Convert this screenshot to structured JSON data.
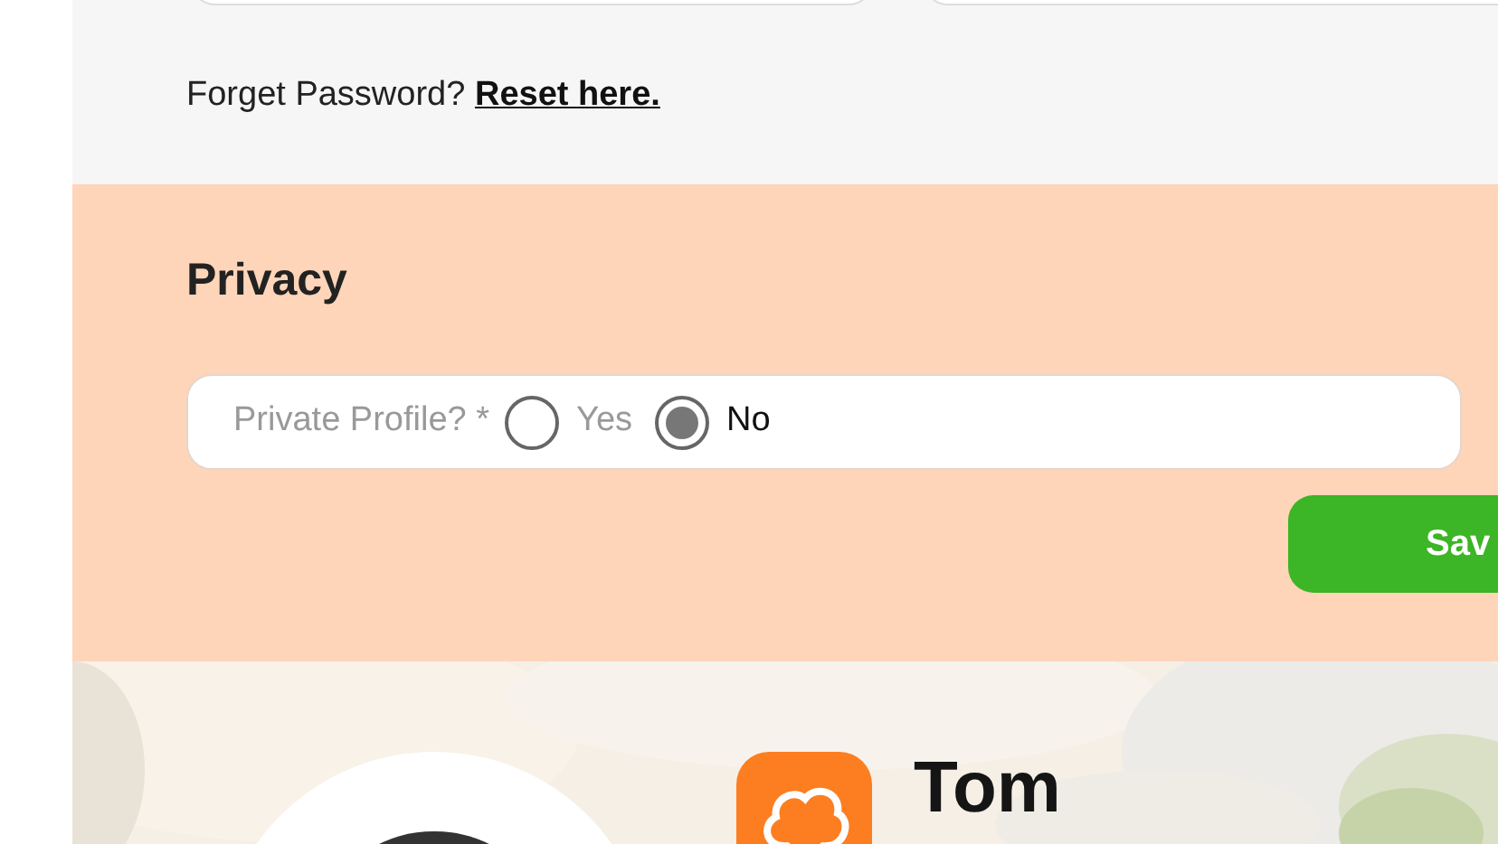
{
  "password_help": {
    "text": "Forget Password?",
    "link": "Reset here."
  },
  "privacy": {
    "title": "Privacy",
    "label": "Private Profile? *",
    "options": [
      {
        "label": "Yes",
        "selected": false
      },
      {
        "label": "No",
        "selected": true
      }
    ]
  },
  "save_button": "Sav",
  "profile": {
    "name": "Tom"
  }
}
